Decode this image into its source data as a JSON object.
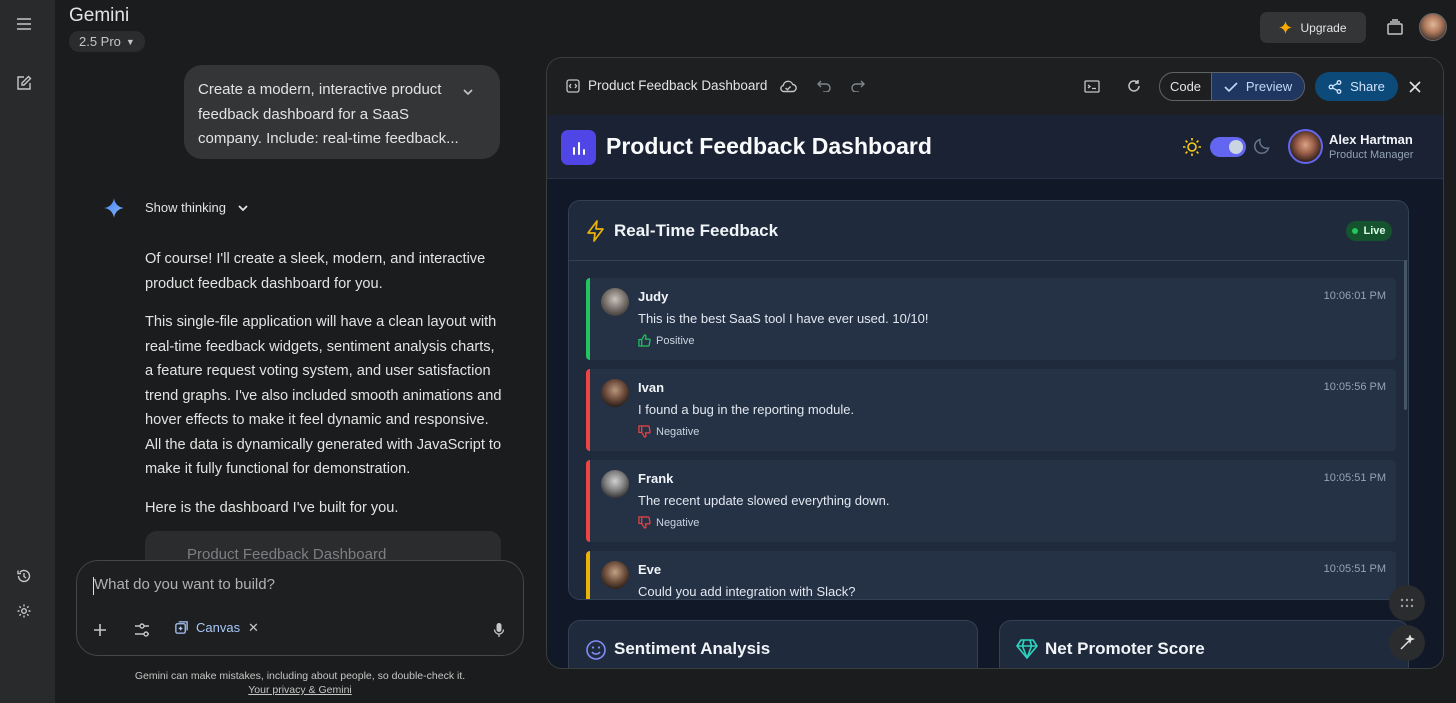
{
  "app": {
    "title": "Gemini",
    "model": "2.5 Pro",
    "upgrade_label": "Upgrade"
  },
  "chat": {
    "user_prompt": "Create a modern, interactive product feedback dashboard for a SaaS company. Include: real-time feedback...",
    "show_thinking_label": "Show thinking",
    "paragraphs": [
      "Of course! I'll create a sleek, modern, and interactive product feedback dashboard for you.",
      "This single-file application will have a clean layout with real-time feedback widgets, sentiment analysis charts, a feature request voting system, and user satisfaction trend graphs. I've also included smooth animations and hover effects to make it feel dynamic and responsive. All the data is dynamically generated with JavaScript to make it fully functional for demonstration.",
      "Here is the dashboard I've built for you."
    ],
    "canvas_card_title": "Product Feedback Dashboard"
  },
  "input": {
    "placeholder": "What do you want to build?",
    "canvas_chip": "Canvas"
  },
  "disclaimer": {
    "text": "Gemini can make mistakes, including about people, so double-check it.",
    "link": "Your privacy & Gemini"
  },
  "panel": {
    "title": "Product Feedback Dashboard",
    "code_label": "Code",
    "preview_label": "Preview",
    "share_label": "Share"
  },
  "dashboard": {
    "title": "Product Feedback Dashboard",
    "user": {
      "name": "Alex Hartman",
      "role": "Product Manager"
    },
    "realtime": {
      "title": "Real-Time Feedback",
      "live_label": "Live",
      "items": [
        {
          "name": "Judy",
          "text": "This is the best SaaS tool I have ever used. 10/10!",
          "sentiment": "Positive",
          "time": "10:06:01 PM",
          "color": "#22c55e"
        },
        {
          "name": "Ivan",
          "text": "I found a bug in the reporting module.",
          "sentiment": "Negative",
          "time": "10:05:56 PM",
          "color": "#ef4444"
        },
        {
          "name": "Frank",
          "text": "The recent update slowed everything down.",
          "sentiment": "Negative",
          "time": "10:05:51 PM",
          "color": "#ef4444"
        },
        {
          "name": "Eve",
          "text": "Could you add integration with Slack?",
          "sentiment": "",
          "time": "10:05:51 PM",
          "color": "#eab308"
        }
      ]
    },
    "sentiment_title": "Sentiment Analysis",
    "nps_title": "Net Promoter Score"
  },
  "colors": {
    "accent": "#4f46e5",
    "positive": "#22c55e",
    "negative": "#ef4444",
    "neutral": "#eab308"
  }
}
